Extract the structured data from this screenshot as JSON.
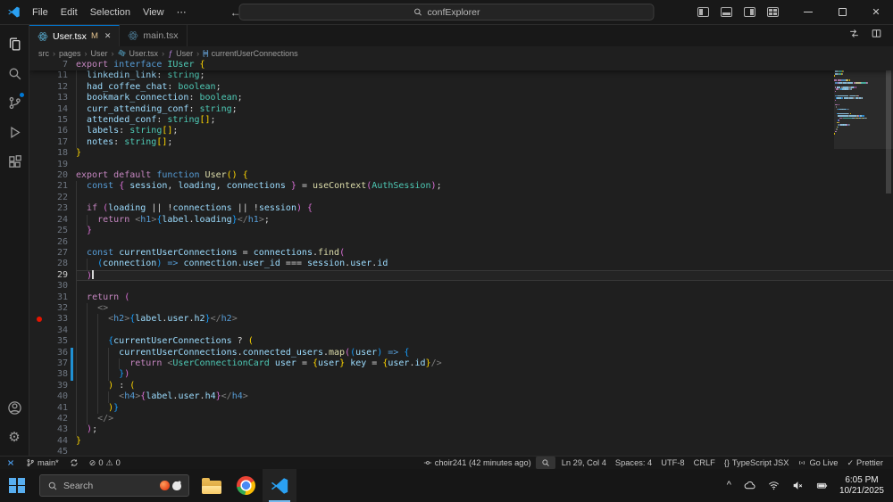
{
  "icons": {
    "chevron": "›",
    "back": "←",
    "forward": "→",
    "more": "⋯",
    "close": "✕",
    "gear": "⚙",
    "error": "⊘",
    "warning": "⚠",
    "check": "✓",
    "caret_up": "^",
    "braces": "{}",
    "func": "ƒ",
    "var_box": "[≡]"
  },
  "titlebar": {
    "menus": [
      "File",
      "Edit",
      "Selection",
      "View"
    ],
    "search": "confExplorer"
  },
  "tabs": [
    {
      "label": "User.tsx",
      "git": "M"
    },
    {
      "label": "main.tsx",
      "git": ""
    }
  ],
  "breadcrumbs": [
    "src",
    "pages",
    "User",
    "User.tsx",
    "User",
    "currentUserConnections"
  ],
  "editor": {
    "sticky": {
      "n": 7,
      "i": 0,
      "t": [
        [
          "k",
          "export"
        ],
        [
          "p",
          " "
        ],
        [
          "d",
          "interface"
        ],
        [
          "p",
          " "
        ],
        [
          "t",
          "IUser"
        ],
        [
          "p",
          " "
        ],
        [
          "b1",
          "{"
        ]
      ]
    },
    "lines": [
      {
        "n": 11,
        "i": 2,
        "t": [
          [
            "v",
            "linkedin_link"
          ],
          [
            "p",
            ": "
          ],
          [
            "t",
            "string"
          ],
          [
            "p",
            ";"
          ]
        ]
      },
      {
        "n": 12,
        "i": 2,
        "t": [
          [
            "v",
            "had_coffee_chat"
          ],
          [
            "p",
            ": "
          ],
          [
            "t",
            "boolean"
          ],
          [
            "p",
            ";"
          ]
        ]
      },
      {
        "n": 13,
        "i": 2,
        "t": [
          [
            "v",
            "bookmark_connection"
          ],
          [
            "p",
            ": "
          ],
          [
            "t",
            "boolean"
          ],
          [
            "p",
            ";"
          ]
        ]
      },
      {
        "n": 14,
        "i": 2,
        "t": [
          [
            "v",
            "curr_attending_conf"
          ],
          [
            "p",
            ": "
          ],
          [
            "t",
            "string"
          ],
          [
            "p",
            ";"
          ]
        ]
      },
      {
        "n": 15,
        "i": 2,
        "t": [
          [
            "v",
            "attended_conf"
          ],
          [
            "p",
            ": "
          ],
          [
            "t",
            "string"
          ],
          [
            "b1",
            "[]"
          ],
          [
            "p",
            ";"
          ]
        ]
      },
      {
        "n": 16,
        "i": 2,
        "t": [
          [
            "v",
            "labels"
          ],
          [
            "p",
            ": "
          ],
          [
            "t",
            "string"
          ],
          [
            "b1",
            "[]"
          ],
          [
            "p",
            ";"
          ]
        ]
      },
      {
        "n": 17,
        "i": 2,
        "t": [
          [
            "v",
            "notes"
          ],
          [
            "p",
            ": "
          ],
          [
            "t",
            "string"
          ],
          [
            "b1",
            "[]"
          ],
          [
            "p",
            ";"
          ]
        ]
      },
      {
        "n": 18,
        "i": 0,
        "t": [
          [
            "b1",
            "}"
          ]
        ]
      },
      {
        "n": 19,
        "i": 0,
        "t": []
      },
      {
        "n": 20,
        "i": 0,
        "t": [
          [
            "k",
            "export"
          ],
          [
            "p",
            " "
          ],
          [
            "k",
            "default"
          ],
          [
            "p",
            " "
          ],
          [
            "d",
            "function"
          ],
          [
            "p",
            " "
          ],
          [
            "f",
            "User"
          ],
          [
            "b1",
            "()"
          ],
          [
            "p",
            " "
          ],
          [
            "b1",
            "{"
          ]
        ]
      },
      {
        "n": 21,
        "i": 2,
        "t": [
          [
            "d",
            "const"
          ],
          [
            "p",
            " "
          ],
          [
            "b2",
            "{"
          ],
          [
            "p",
            " "
          ],
          [
            "v",
            "session"
          ],
          [
            "p",
            ", "
          ],
          [
            "v",
            "loading"
          ],
          [
            "p",
            ", "
          ],
          [
            "v",
            "connections"
          ],
          [
            "p",
            " "
          ],
          [
            "b2",
            "}"
          ],
          [
            "p",
            " "
          ],
          [
            "o",
            "="
          ],
          [
            "p",
            " "
          ],
          [
            "f",
            "useContext"
          ],
          [
            "b2",
            "("
          ],
          [
            "t",
            "AuthSession"
          ],
          [
            "b2",
            ")"
          ],
          [
            "p",
            ";"
          ]
        ]
      },
      {
        "n": 22,
        "i": 2,
        "t": []
      },
      {
        "n": 23,
        "i": 2,
        "t": [
          [
            "k",
            "if"
          ],
          [
            "p",
            " "
          ],
          [
            "b2",
            "("
          ],
          [
            "v",
            "loading"
          ],
          [
            "p",
            " "
          ],
          [
            "o",
            "||"
          ],
          [
            "p",
            " "
          ],
          [
            "o",
            "!"
          ],
          [
            "v",
            "connections"
          ],
          [
            "p",
            " "
          ],
          [
            "o",
            "||"
          ],
          [
            "p",
            " "
          ],
          [
            "o",
            "!"
          ],
          [
            "v",
            "session"
          ],
          [
            "b2",
            ")"
          ],
          [
            "p",
            " "
          ],
          [
            "b2",
            "{"
          ]
        ]
      },
      {
        "n": 24,
        "i": 4,
        "t": [
          [
            "k",
            "return"
          ],
          [
            "p",
            " "
          ],
          [
            "g",
            "<"
          ],
          [
            "tg",
            "h1"
          ],
          [
            "g",
            ">"
          ],
          [
            "b3",
            "{"
          ],
          [
            "v",
            "label"
          ],
          [
            "p",
            "."
          ],
          [
            "v",
            "loading"
          ],
          [
            "b3",
            "}"
          ],
          [
            "g",
            "</"
          ],
          [
            "tg",
            "h1"
          ],
          [
            "g",
            ">"
          ],
          [
            "p",
            ";"
          ]
        ]
      },
      {
        "n": 25,
        "i": 2,
        "t": [
          [
            "b2",
            "}"
          ]
        ]
      },
      {
        "n": 26,
        "i": 2,
        "t": []
      },
      {
        "n": 27,
        "i": 2,
        "t": [
          [
            "d",
            "const"
          ],
          [
            "p",
            " "
          ],
          [
            "v",
            "currentUserConnections"
          ],
          [
            "p",
            " "
          ],
          [
            "o",
            "="
          ],
          [
            "p",
            " "
          ],
          [
            "v",
            "connections"
          ],
          [
            "p",
            "."
          ],
          [
            "f",
            "find"
          ],
          [
            "b2",
            "("
          ]
        ]
      },
      {
        "n": 28,
        "i": 4,
        "t": [
          [
            "b3",
            "("
          ],
          [
            "v",
            "connection"
          ],
          [
            "b3",
            ")"
          ],
          [
            "p",
            " "
          ],
          [
            "d",
            "=>"
          ],
          [
            "p",
            " "
          ],
          [
            "v",
            "connection"
          ],
          [
            "p",
            "."
          ],
          [
            "v",
            "user_id"
          ],
          [
            "p",
            " "
          ],
          [
            "o",
            "==="
          ],
          [
            "p",
            " "
          ],
          [
            "v",
            "session"
          ],
          [
            "p",
            "."
          ],
          [
            "v",
            "user"
          ],
          [
            "p",
            "."
          ],
          [
            "v",
            "id"
          ]
        ]
      },
      {
        "n": 29,
        "i": 2,
        "cur": true,
        "t": [
          [
            "b2",
            ")"
          ]
        ]
      },
      {
        "n": 30,
        "i": 2,
        "t": []
      },
      {
        "n": 31,
        "i": 2,
        "t": [
          [
            "k",
            "return"
          ],
          [
            "p",
            " "
          ],
          [
            "b2",
            "("
          ]
        ]
      },
      {
        "n": 32,
        "i": 4,
        "t": [
          [
            "g",
            "<>"
          ]
        ]
      },
      {
        "n": 33,
        "i": 6,
        "bp": true,
        "t": [
          [
            "g",
            "<"
          ],
          [
            "tg",
            "h2"
          ],
          [
            "g",
            ">"
          ],
          [
            "b3",
            "{"
          ],
          [
            "v",
            "label"
          ],
          [
            "p",
            "."
          ],
          [
            "v",
            "user"
          ],
          [
            "p",
            "."
          ],
          [
            "v",
            "h2"
          ],
          [
            "b3",
            "}"
          ],
          [
            "g",
            "</"
          ],
          [
            "tg",
            "h2"
          ],
          [
            "g",
            ">"
          ]
        ]
      },
      {
        "n": 34,
        "i": 6,
        "t": []
      },
      {
        "n": 35,
        "i": 6,
        "t": [
          [
            "b3",
            "{"
          ],
          [
            "v",
            "currentUserConnections"
          ],
          [
            "p",
            " "
          ],
          [
            "o",
            "?"
          ],
          [
            "p",
            " "
          ],
          [
            "b1",
            "("
          ]
        ]
      },
      {
        "n": 36,
        "i": 8,
        "mod": true,
        "t": [
          [
            "v",
            "currentUserConnections"
          ],
          [
            "p",
            "."
          ],
          [
            "v",
            "connected_users"
          ],
          [
            "p",
            "."
          ],
          [
            "f",
            "map"
          ],
          [
            "b2",
            "("
          ],
          [
            "b3",
            "("
          ],
          [
            "v",
            "user"
          ],
          [
            "b3",
            ")"
          ],
          [
            "p",
            " "
          ],
          [
            "d",
            "=>"
          ],
          [
            "p",
            " "
          ],
          [
            "b3",
            "{"
          ]
        ]
      },
      {
        "n": 37,
        "i": 10,
        "mod": true,
        "t": [
          [
            "k",
            "return"
          ],
          [
            "p",
            " "
          ],
          [
            "g",
            "<"
          ],
          [
            "t",
            "UserConnectionCard"
          ],
          [
            "p",
            " "
          ],
          [
            "v",
            "user"
          ],
          [
            "p",
            " "
          ],
          [
            "o",
            "="
          ],
          [
            "p",
            " "
          ],
          [
            "b1",
            "{"
          ],
          [
            "v",
            "user"
          ],
          [
            "b1",
            "}"
          ],
          [
            "p",
            " "
          ],
          [
            "v",
            "key"
          ],
          [
            "p",
            " "
          ],
          [
            "o",
            "="
          ],
          [
            "p",
            " "
          ],
          [
            "b1",
            "{"
          ],
          [
            "v",
            "user"
          ],
          [
            "p",
            "."
          ],
          [
            "v",
            "id"
          ],
          [
            "b1",
            "}"
          ],
          [
            "g",
            "/>"
          ]
        ]
      },
      {
        "n": 38,
        "i": 8,
        "mod": true,
        "t": [
          [
            "b3",
            "}"
          ],
          [
            "b2",
            ")"
          ]
        ]
      },
      {
        "n": 39,
        "i": 6,
        "t": [
          [
            "b1",
            ")"
          ],
          [
            "p",
            " "
          ],
          [
            "o",
            ":"
          ],
          [
            "p",
            " "
          ],
          [
            "b1",
            "("
          ]
        ]
      },
      {
        "n": 40,
        "i": 8,
        "t": [
          [
            "g",
            "<"
          ],
          [
            "tg",
            "h4"
          ],
          [
            "g",
            ">"
          ],
          [
            "b2",
            "{"
          ],
          [
            "v",
            "label"
          ],
          [
            "p",
            "."
          ],
          [
            "v",
            "user"
          ],
          [
            "p",
            "."
          ],
          [
            "v",
            "h4"
          ],
          [
            "b2",
            "}"
          ],
          [
            "g",
            "</"
          ],
          [
            "tg",
            "h4"
          ],
          [
            "g",
            ">"
          ]
        ]
      },
      {
        "n": 41,
        "i": 6,
        "t": [
          [
            "b1",
            ")"
          ],
          [
            "b3",
            "}"
          ]
        ]
      },
      {
        "n": 42,
        "i": 4,
        "t": [
          [
            "g",
            "</>"
          ]
        ]
      },
      {
        "n": 43,
        "i": 2,
        "t": [
          [
            "b2",
            ")"
          ],
          [
            "p",
            ";"
          ]
        ]
      },
      {
        "n": 44,
        "i": 0,
        "t": [
          [
            "b1",
            "}"
          ]
        ]
      },
      {
        "n": 45,
        "i": 0,
        "t": []
      }
    ]
  },
  "status": {
    "branch": "main*",
    "errors": "0",
    "warnings": "0",
    "commit": "choir241 (42 minutes ago)",
    "line_col": "Ln 29, Col 4",
    "indent": "Spaces: 4",
    "encoding": "UTF-8",
    "eol": "CRLF",
    "language": "TypeScript JSX",
    "go_live": "Go Live",
    "formatter": "Prettier"
  },
  "taskbar": {
    "search_placeholder": "Search",
    "time": "6:05 PM",
    "date": "10/21/2025"
  }
}
